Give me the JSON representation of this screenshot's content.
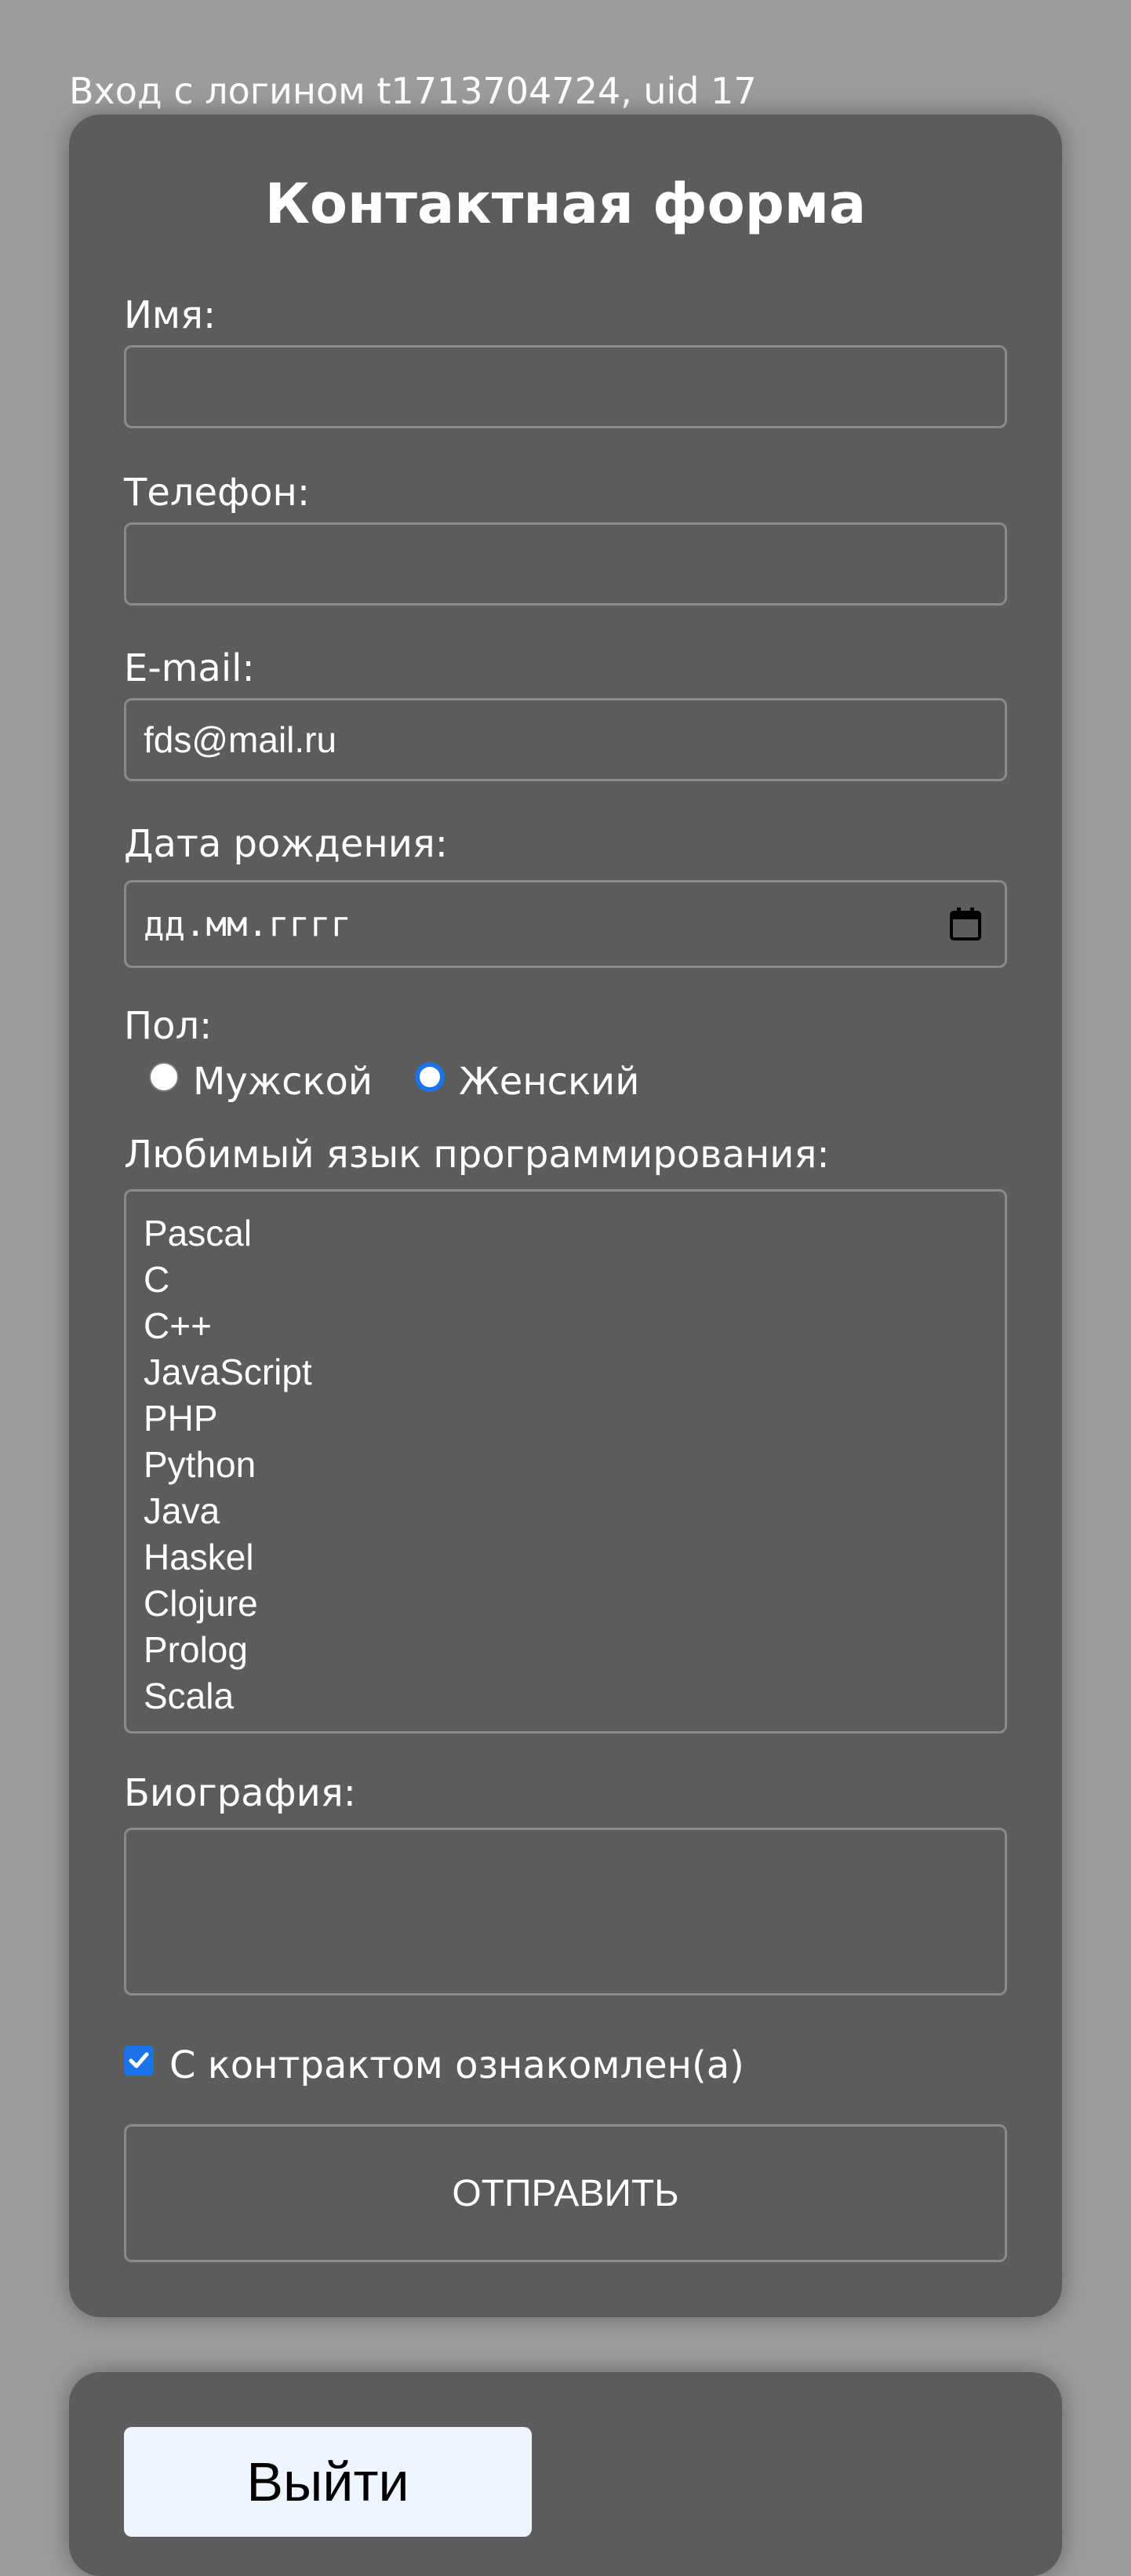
{
  "header": {
    "login_text": "Вход с логином t1713704724, uid 17"
  },
  "form": {
    "title": "Контактная форма",
    "name": {
      "label": "Имя:",
      "value": ""
    },
    "phone": {
      "label": "Телефон:",
      "value": ""
    },
    "email": {
      "label": "E-mail:",
      "value": "fds@mail.ru"
    },
    "birthdate": {
      "label": "Дата рождения:",
      "placeholder": "дд.мм.гггг",
      "icon": "calendar-icon"
    },
    "gender": {
      "label": "Пол:",
      "options": [
        {
          "label": "Мужской",
          "selected": false
        },
        {
          "label": "Женский",
          "selected": true
        }
      ]
    },
    "languages": {
      "label": "Любимый язык программирования:",
      "options": [
        "Pascal",
        "C",
        "C++",
        "JavaScript",
        "PHP",
        "Python",
        "Java",
        "Haskel",
        "Clojure",
        "Prolog",
        "Scala"
      ]
    },
    "bio": {
      "label": "Биография:",
      "value": ""
    },
    "contract": {
      "label": "С контрактом ознакомлен(а)",
      "checked": true
    },
    "submit_label": "ОТПРАВИТЬ"
  },
  "logout": {
    "label": "Выйти"
  },
  "colors": {
    "page_bg": "#9b9c9e",
    "card_bg": "#5c5c5c",
    "accent": "#1a73e8"
  }
}
